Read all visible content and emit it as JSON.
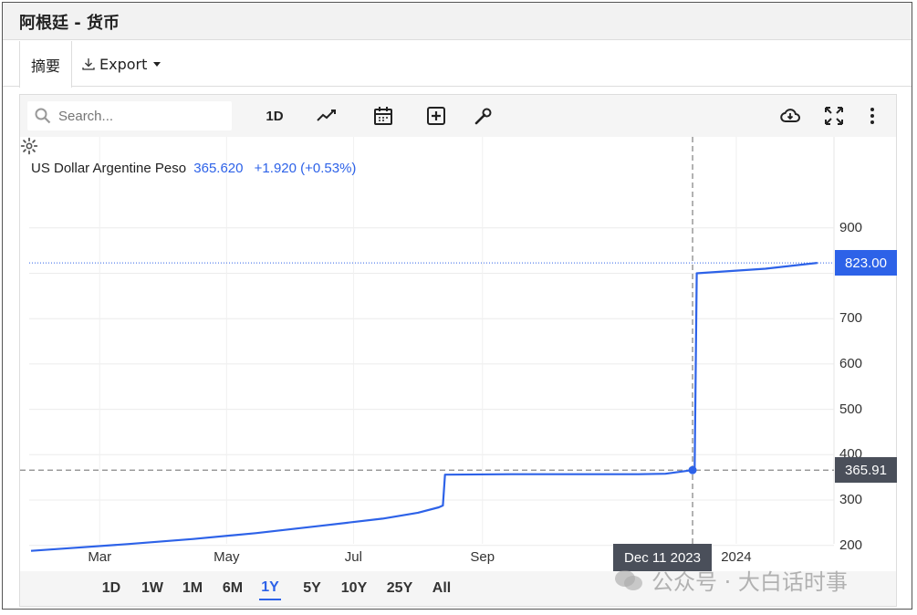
{
  "window": {
    "title": "阿根廷 - 货币"
  },
  "tabs": {
    "summary_label": "摘要",
    "export_label": "Export"
  },
  "toolbar": {
    "search_placeholder": "Search...",
    "interval_label": "1D",
    "icons": [
      "search-icon",
      "line-chart-icon",
      "calendar-icon",
      "add-indicator-icon",
      "wrench-icon",
      "cloud-download-icon",
      "fullscreen-icon",
      "more-vert-icon"
    ]
  },
  "legend": {
    "instrument": "US Dollar Argentine Peso",
    "value": "365.620",
    "change": "+1.920 (+0.53%)"
  },
  "price_labels": {
    "last": "823.00",
    "crosshair": "365.91"
  },
  "crosshair_date": "Dec 11 2023",
  "range_buttons": [
    "1D",
    "1W",
    "1M",
    "6M",
    "1Y",
    "5Y",
    "10Y",
    "25Y",
    "All"
  ],
  "active_range": "1Y",
  "colors": {
    "line": "#2d62e8",
    "label_dark": "#4a4f5a",
    "accent": "#2d62e8"
  },
  "watermark": "公众号 · 大白话时事",
  "chart_data": {
    "type": "line",
    "title": "",
    "series": [
      {
        "name": "US Dollar Argentine Peso",
        "x": [
          "2023-01-27",
          "2023-02-15",
          "2023-03-15",
          "2023-04-15",
          "2023-05-15",
          "2023-06-15",
          "2023-07-15",
          "2023-08-01",
          "2023-08-11",
          "2023-08-13",
          "2023-08-14",
          "2023-09-15",
          "2023-10-15",
          "2023-11-15",
          "2023-11-28",
          "2023-12-11",
          "2023-12-12",
          "2023-12-13",
          "2024-01-15",
          "2024-02-09"
        ],
        "y": [
          188,
          194,
          203,
          214,
          227,
          243,
          259,
          272,
          284,
          288,
          356,
          357,
          357,
          357,
          358,
          365.91,
          366,
          800,
          810,
          823
        ]
      }
    ],
    "xticks": [
      "Mar",
      "May",
      "Jul",
      "Sep",
      "2024"
    ],
    "yticks": [
      200,
      300,
      400,
      500,
      600,
      700,
      800,
      900
    ],
    "ylim": [
      100,
      950
    ],
    "xlim": [
      "2023-01-27",
      "2024-02-15"
    ],
    "last_value": 823.0,
    "crosshair": {
      "x": "2023-12-11",
      "y": 365.91
    },
    "grid": true
  }
}
